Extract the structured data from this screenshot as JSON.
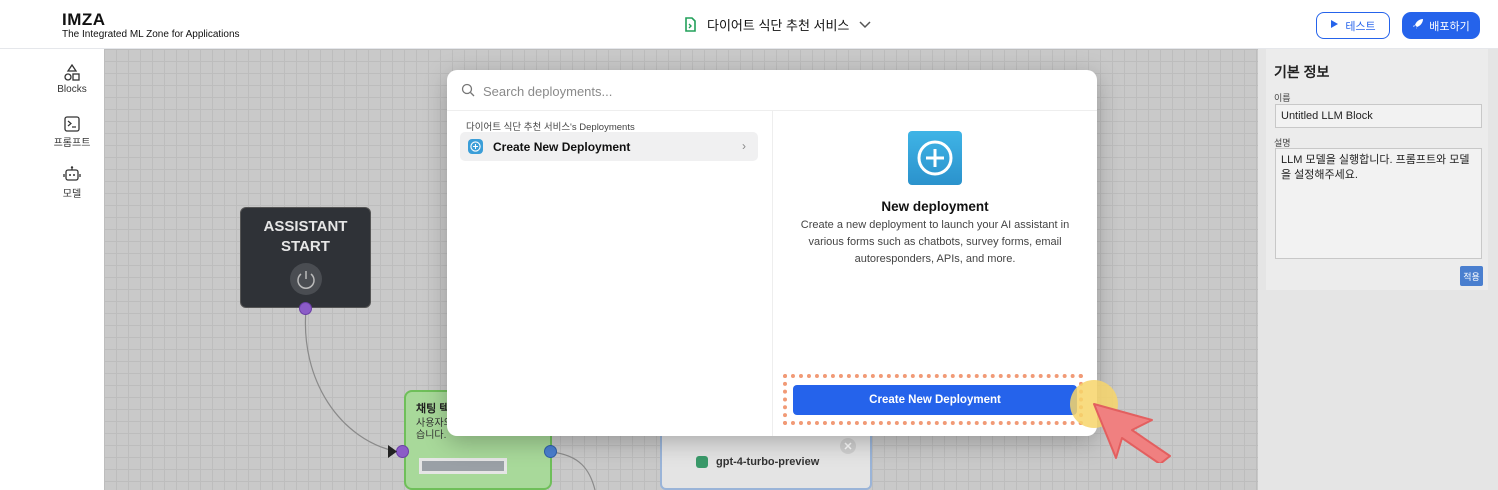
{
  "header": {
    "brand_name": "IMZA",
    "brand_subtitle": "The Integrated ML Zone for Applications",
    "project_title": "다이어트 식단 추천 서비스",
    "test_label": "테스트",
    "deploy_label": "배포하기"
  },
  "toolbar": {
    "items": [
      {
        "label": "Blocks",
        "icon": "blocks-icon"
      },
      {
        "label": "프롬프트",
        "icon": "terminal-icon"
      },
      {
        "label": "모델",
        "icon": "robot-icon"
      }
    ]
  },
  "canvas": {
    "assistant_node_line1": "ASSISTANT",
    "assistant_node_line2": "START",
    "chat_node_title": "채팅 텍",
    "chat_node_desc_line1": "사용자의",
    "chat_node_desc_line2": "습니다.",
    "llm_model": "gpt-4-turbo-preview"
  },
  "right_panel": {
    "title": "기본 정보",
    "name_label": "이름",
    "name_value": "Untitled LLM Block",
    "desc_label": "설명",
    "desc_value": "LLM 모델을 실행합니다. 프롬프트와 모델을 설정해주세요.",
    "apply_label": "적용"
  },
  "modal": {
    "search_placeholder": "Search deployments...",
    "group_label": "다이어트 식단 추천 서비스's Deployments",
    "item_label": "Create New Deployment",
    "detail_title": "New deployment",
    "detail_description": "Create a new deployment to launch your AI assistant in various forms such as chatbots, survey forms, email autoresponders, APIs, and more.",
    "cta_label": "Create New Deployment"
  },
  "colors": {
    "accent": "#2563eb",
    "highlight": "#f19a76",
    "cursor": "#f08080"
  }
}
